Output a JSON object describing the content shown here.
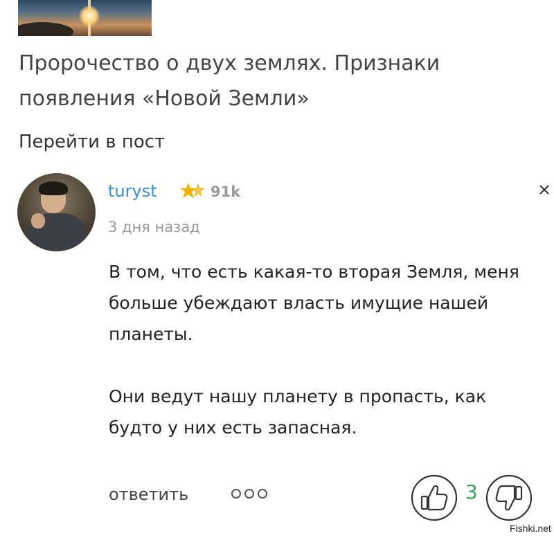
{
  "post": {
    "title": "Пророчество о двух землях. Признаки появления «Новой Земли»",
    "goto_label": "Перейти в пост"
  },
  "comment": {
    "username": "turyst",
    "karma": "91k",
    "timestamp": "3 дня назад",
    "paragraphs": [
      "В том, что есть какая-то вторая Земля, меня больше убеждают власть имущие нашей планеты.",
      "Они ведут нашу планету в пропасть, как будто у них есть запасная."
    ],
    "reply_label": "ответить",
    "like_count": "3"
  },
  "icons": {
    "more": "more-dots-icon",
    "close": "close-icon",
    "like": "thumbs-up-icon",
    "dislike": "thumbs-down-icon",
    "rank": "star-rank-icon"
  },
  "colors": {
    "username": "#3a8fd6",
    "like_count": "#2fa84f",
    "rank_star": "#f0b400"
  },
  "watermark": "Fishki.net"
}
